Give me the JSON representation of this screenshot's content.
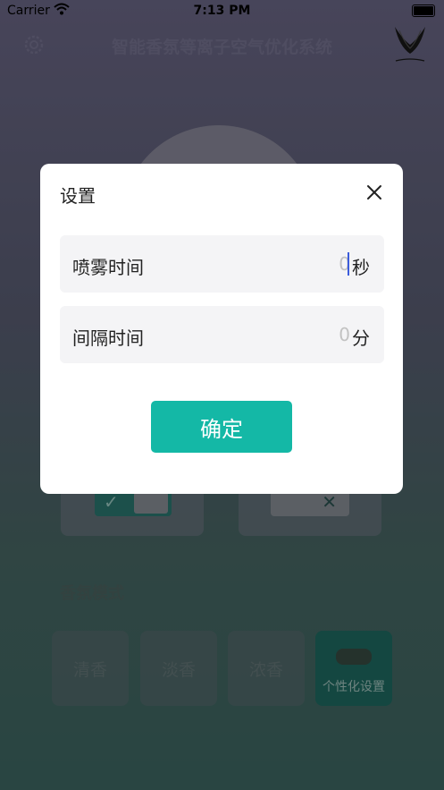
{
  "status": {
    "carrier": "Carrier",
    "time": "7:13 PM"
  },
  "app": {
    "title": "智能香氛等离子空气优化系统"
  },
  "modes": {
    "title": "香氛模式",
    "items": [
      "清香",
      "淡香",
      "浓香",
      "个性化设置"
    ]
  },
  "dialog": {
    "title": "设置",
    "spray": {
      "label": "喷雾时间",
      "value": "0",
      "unit": "秒"
    },
    "interval": {
      "label": "间隔时间",
      "value": "0",
      "unit": "分"
    },
    "confirm_label": "确定"
  },
  "colors": {
    "accent": "#14b8a6",
    "dialog_bg": "#ffffff",
    "row_bg": "#f4f4f6"
  }
}
